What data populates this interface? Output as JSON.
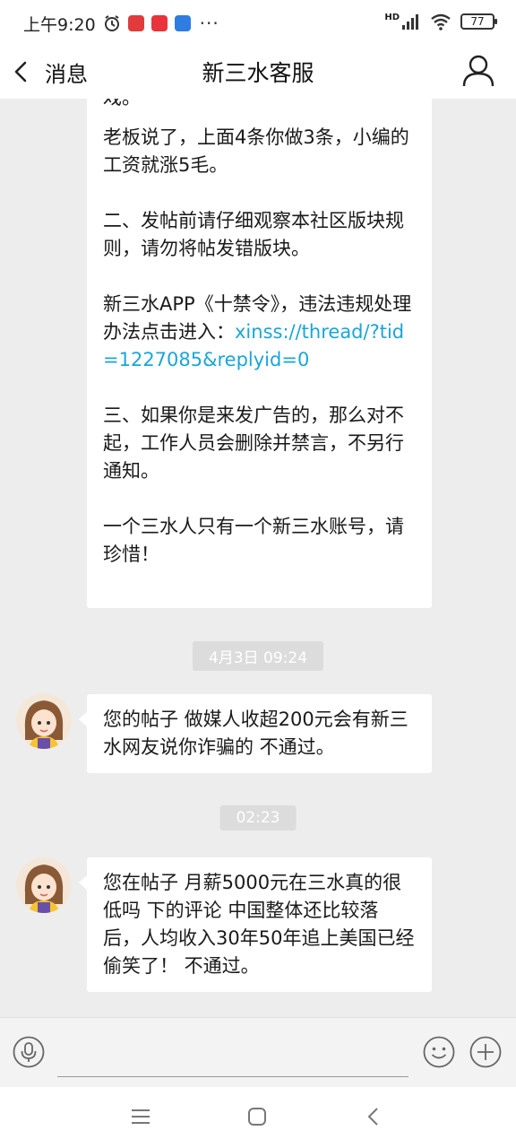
{
  "status_bar": {
    "time": "上午9:20",
    "network": "HD",
    "battery": "77",
    "more": "···"
  },
  "header": {
    "back_label": "消息",
    "title": "新三水客服"
  },
  "messages": {
    "rules_para1": "老板说了，上面4条你做3条，小编的工资就涨5毛。",
    "rules_para2": "二、发帖前请仔细观察本社区版块规则，请勿将帖发错版块。",
    "rules_para3_text": "新三水APP《十禁令》，违法违规处理办法点击进入：",
    "rules_para3_link": "xinss://thread/?tid=1227085&replyid=0",
    "rules_para4": "三、如果你是来发广告的，那么对不起，工作人员会删除并禁言，不另行通知。",
    "rules_para5": "一个三水人只有一个新三水账号，请珍惜！",
    "timestamp1": "4月3日 09:24",
    "msg1": "您的帖子 做媒人收超200元会有新三水网友说你诈骗的 不通过。",
    "timestamp2": "02:23",
    "msg2": "您在帖子 月薪5000元在三水真的很低吗 下的评论 中国整体还比较落后，人均收入30年50年追上美国已经偷笑了！  不通过。"
  },
  "input": {
    "value": "",
    "placeholder": ""
  },
  "colors": {
    "link": "#1aa6d9",
    "background": "#ededed",
    "bubble": "#ffffff"
  },
  "icons": [
    "alarm-icon",
    "back-icon",
    "user-profile-icon",
    "voice-icon",
    "emoji-icon",
    "plus-icon",
    "menu-icon",
    "home-icon",
    "nav-back-icon"
  ]
}
